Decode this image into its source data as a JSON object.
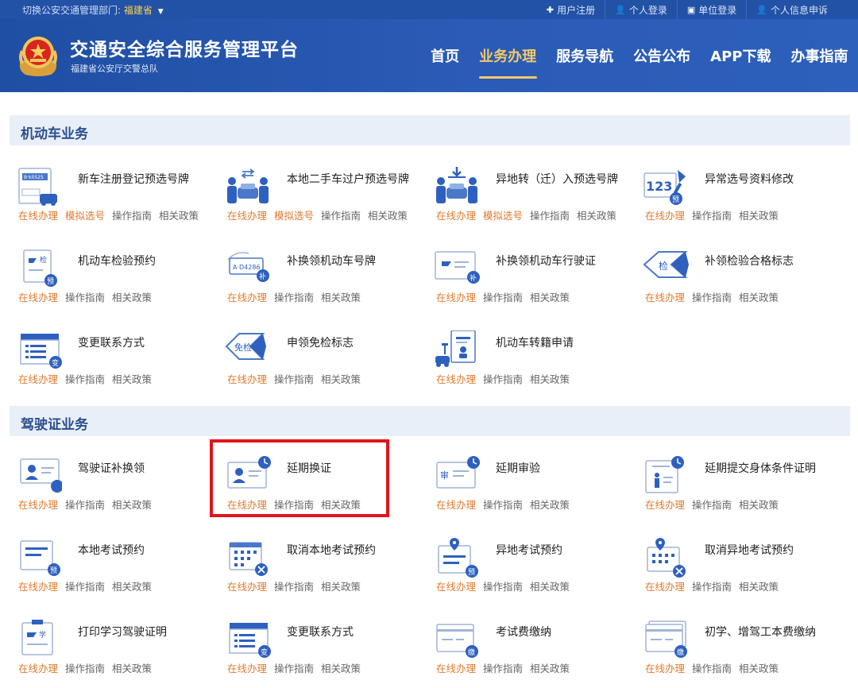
{
  "topbar": {
    "region_label": "切换公安交通管理部门:",
    "region_value": "福建省",
    "links": [
      {
        "icon": "plus-icon",
        "glyph": "✚",
        "label": "用户注册"
      },
      {
        "icon": "user-icon",
        "glyph": "👤",
        "label": "个人登录"
      },
      {
        "icon": "building-icon",
        "glyph": "▣",
        "label": "单位登录"
      },
      {
        "icon": "user-info-icon",
        "glyph": "👤",
        "label": "个人信息申诉"
      }
    ]
  },
  "header": {
    "title": "交通安全综合服务管理平台",
    "subtitle": "福建省公安厅交警总队",
    "nav": [
      "首页",
      "业务办理",
      "服务导航",
      "公告公布",
      "APP下载",
      "办事指南"
    ],
    "active_nav": "业务办理"
  },
  "colors": {
    "brand_blue": "#2252a6",
    "accent_orange": "#e07a2e",
    "highlight_red": "#e3131b"
  },
  "sections": [
    {
      "title": "机动车业务",
      "items": [
        {
          "name": "新车注册登记预选号牌",
          "icon": "new-car-plate-icon",
          "links": [
            "在线办理",
            "模拟选号",
            "操作指南",
            "相关政策"
          ]
        },
        {
          "name": "本地二手车过户预选号牌",
          "icon": "used-car-transfer-icon",
          "links": [
            "在线办理",
            "模拟选号",
            "操作指南",
            "相关政策"
          ]
        },
        {
          "name": "异地转（迁）入预选号牌",
          "icon": "car-transfer-in-icon",
          "links": [
            "在线办理",
            "模拟选号",
            "操作指南",
            "相关政策"
          ]
        },
        {
          "name": "异常选号资料修改",
          "icon": "plate-number-edit-icon",
          "links": [
            "在线办理",
            "操作指南",
            "相关政策"
          ]
        },
        {
          "name": "机动车检验预约",
          "icon": "inspection-appointment-icon",
          "links": [
            "在线办理",
            "操作指南",
            "相关政策"
          ]
        },
        {
          "name": "补换领机动车号牌",
          "icon": "plate-replace-icon",
          "links": [
            "在线办理",
            "操作指南",
            "相关政策"
          ]
        },
        {
          "name": "补换领机动车行驶证",
          "icon": "driving-permit-replace-icon",
          "links": [
            "在线办理",
            "操作指南",
            "相关政策"
          ]
        },
        {
          "name": "补领检验合格标志",
          "icon": "inspection-sticker-icon",
          "links": [
            "在线办理",
            "操作指南",
            "相关政策"
          ]
        },
        {
          "name": "变更联系方式",
          "icon": "contact-change-icon",
          "links": [
            "在线办理",
            "操作指南",
            "相关政策"
          ]
        },
        {
          "name": "申领免检标志",
          "icon": "exempt-sticker-icon",
          "links": [
            "在线办理",
            "操作指南",
            "相关政策"
          ]
        },
        {
          "name": "机动车转籍申请",
          "icon": "vehicle-transfer-icon",
          "links": [
            "在线办理",
            "操作指南",
            "相关政策"
          ]
        }
      ]
    },
    {
      "title": "驾驶证业务",
      "items": [
        {
          "name": "驾驶证补换领",
          "icon": "license-replace-icon",
          "links": [
            "在线办理",
            "操作指南",
            "相关政策"
          ]
        },
        {
          "name": "延期换证",
          "icon": "license-extend-icon",
          "links": [
            "在线办理",
            "操作指南",
            "相关政策"
          ]
        },
        {
          "name": "延期审验",
          "icon": "review-extend-icon",
          "links": [
            "在线办理",
            "操作指南",
            "相关政策"
          ]
        },
        {
          "name": "延期提交身体条件证明",
          "icon": "health-cert-extend-icon",
          "links": [
            "在线办理",
            "操作指南",
            "相关政策"
          ]
        },
        {
          "name": "本地考试预约",
          "icon": "exam-booking-icon",
          "links": [
            "在线办理",
            "操作指南",
            "相关政策"
          ]
        },
        {
          "name": "取消本地考试预约",
          "icon": "cancel-exam-icon",
          "links": [
            "在线办理",
            "操作指南",
            "相关政策"
          ]
        },
        {
          "name": "异地考试预约",
          "icon": "remote-exam-booking-icon",
          "links": [
            "在线办理",
            "操作指南",
            "相关政策"
          ]
        },
        {
          "name": "取消异地考试预约",
          "icon": "cancel-remote-exam-icon",
          "links": [
            "在线办理",
            "操作指南",
            "相关政策"
          ]
        },
        {
          "name": "打印学习驾驶证明",
          "icon": "learner-print-icon",
          "links": [
            "在线办理",
            "操作指南",
            "相关政策"
          ]
        },
        {
          "name": "变更联系方式",
          "icon": "contact-change-icon",
          "links": [
            "在线办理",
            "操作指南",
            "相关政策"
          ]
        },
        {
          "name": "考试费缴纳",
          "icon": "exam-fee-icon",
          "links": [
            "在线办理",
            "操作指南",
            "相关政策"
          ]
        },
        {
          "name": "初学、增驾工本费缴纳",
          "icon": "fee-payment-icon",
          "links": [
            "在线办理",
            "操作指南",
            "相关政策"
          ]
        }
      ]
    }
  ]
}
